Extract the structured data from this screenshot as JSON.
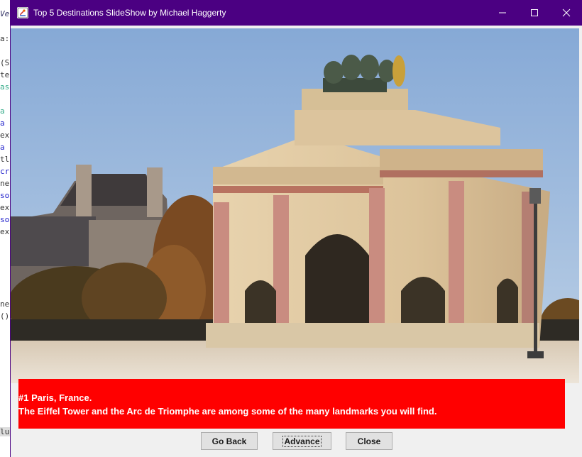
{
  "window": {
    "title": "Top 5 Destinations SlideShow by Michael Haggerty",
    "titlebar_color": "#4b0082"
  },
  "slide": {
    "image_subject": "Arc de Triomphe du Carrousel, Paris",
    "caption_line1": "#1 Paris, France.",
    "caption_line2": "The Eiffel Tower and the Arc de Triomphe are among some of the many landmarks you will find.",
    "caption_bg": "#ff0000"
  },
  "buttons": {
    "back_label": "Go Back",
    "advance_label": "Advance",
    "close_label": "Close"
  },
  "background_editor": {
    "fragments": [
      "Ve",
      "a:",
      "(Sy",
      "ter",
      "ase",
      "a",
      "a",
      "ext",
      "a",
      "tl",
      "cre",
      "ne",
      "so",
      "ext",
      "so",
      "ext",
      "ne",
      "()",
      "lug"
    ]
  }
}
